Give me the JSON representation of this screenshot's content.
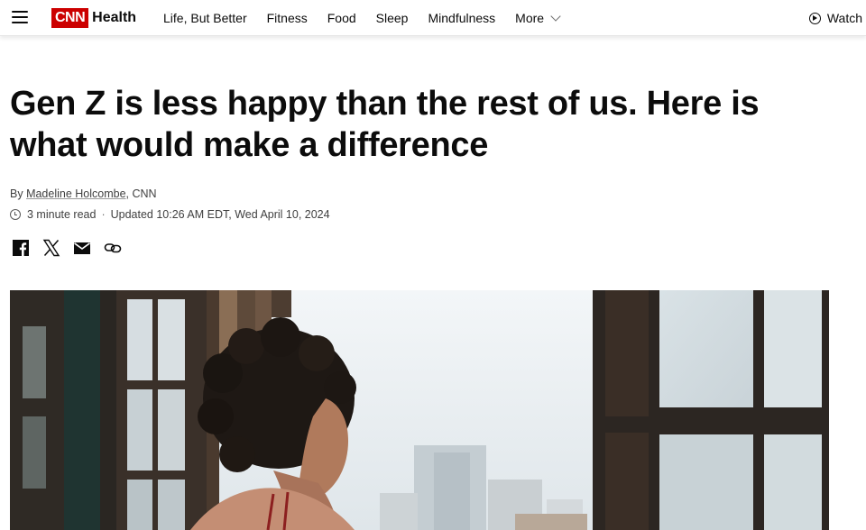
{
  "header": {
    "logo_text": "CNN",
    "section": "Health",
    "nav": [
      {
        "label": "Life, But Better"
      },
      {
        "label": "Fitness"
      },
      {
        "label": "Food"
      },
      {
        "label": "Sleep"
      },
      {
        "label": "Mindfulness"
      }
    ],
    "more_label": "More",
    "watch_label": "Watch",
    "brand_color": "#cc0000"
  },
  "article": {
    "headline": "Gen Z is less happy than the rest of us. Here is what would make a difference",
    "byline_prefix": "By ",
    "author": "Madeline Holcombe",
    "byline_suffix": ", CNN",
    "read_time": "3 minute read",
    "updated": "Updated 10:26 AM EDT, Wed April 10, 2024",
    "share_icons": [
      "facebook-icon",
      "x-icon",
      "email-icon",
      "link-icon"
    ]
  }
}
